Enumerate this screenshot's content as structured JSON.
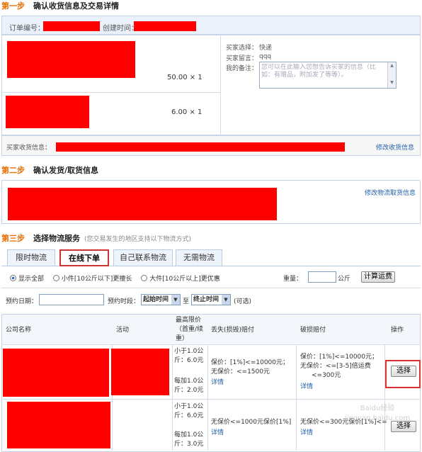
{
  "step1": {
    "label": "第一步",
    "title": "确认收货信息及交易详情",
    "order_no_label": "订单编号：",
    "created_label": "创建时间：",
    "item1_price": "50.00 × 1",
    "item2_price": "6.00 × 1",
    "buyer_choice_label": "买家选择：",
    "buyer_choice_value": "快递",
    "buyer_msg_label": "买家留言：",
    "buyer_msg_value": "qqq",
    "remark_label": "我的备注：",
    "remark_placeholder": "您可以在此输入您想告诉买家的信息（比如：有赠品，附加发了等等）。",
    "address_label": "买家收货信息：",
    "edit_address": "修改收货信息"
  },
  "step2": {
    "label": "第二步",
    "title": "确认发货/取货信息",
    "edit_link": "修改物流取货信息"
  },
  "step3": {
    "label": "第三步",
    "title": "选择物流服务",
    "note": "(您交易发生的地区支持以下物流方式)",
    "tabs": [
      "限时物流",
      "在线下单",
      "自己联系物流",
      "无需物流"
    ],
    "filters": [
      "显示全部",
      "小件[10公斤以下]更擅长",
      "大件[10公斤以上]更优惠"
    ],
    "weight_label": "重量：",
    "weight_unit": "公斤",
    "calc_button": "计算运费",
    "pickup_date_label": "预约日期：",
    "pickup_slot_label": "预约时段：",
    "start_time": "起始时间",
    "to": "至",
    "end_time": "终止时间",
    "optional": "(可选)"
  },
  "table": {
    "headers": {
      "company": "公司名称",
      "activity": "活动",
      "max_price": "最高限价（首重/续重）",
      "loss": "丢失(损毁)赔付",
      "damage": "破损赔付",
      "action": "操作"
    },
    "rows": [
      {
        "price_first": "小于1.0公斤：6.0元",
        "price_extra": "每加1.0公斤：2.0元",
        "loss_a": "保价：[1%]<=10000元；",
        "loss_b": "无保价：<=1500元",
        "loss_more": "详情",
        "damage_a": "保价：[1%]<=10000元；",
        "damage_b": "无保价：<=[3-5]倍运费",
        "damage_c": "<=300元",
        "damage_more": "详情",
        "select": "选择"
      },
      {
        "price_first": "小于1.0公斤：6.0元",
        "price_extra": "每加1.0公斤：3.0元",
        "loss_a": "无保价<=1000元保价[1%]",
        "loss_more": "详情",
        "damage_a": "无保价<=300元保价[1%]<=",
        "damage_more": "详情",
        "select": "选择"
      }
    ]
  },
  "watermark": "Baidu经验 jingyan.baidu.com"
}
